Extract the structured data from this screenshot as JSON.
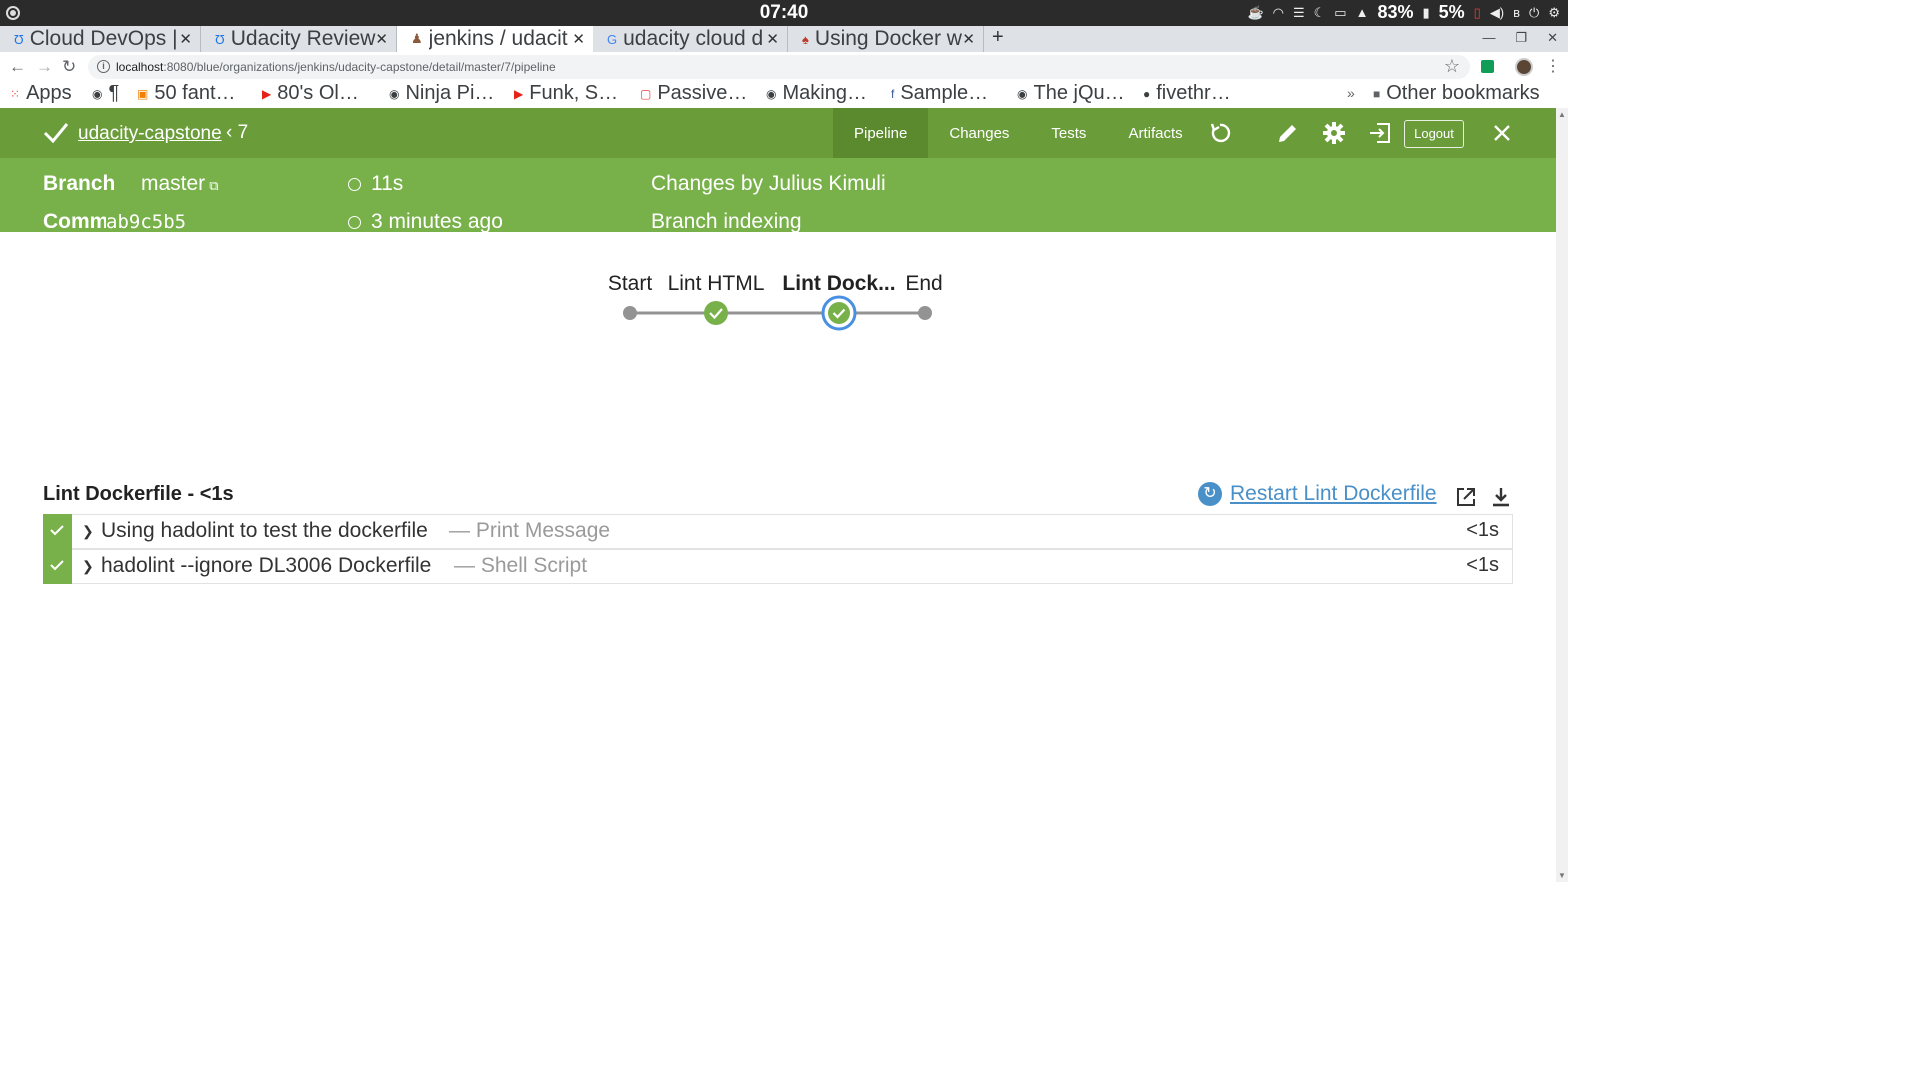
{
  "os": {
    "clock": "07:40",
    "tray": {
      "battery1": "83%",
      "battery2": "5%"
    }
  },
  "browser": {
    "tabs": [
      {
        "title": "Cloud DevOps |",
        "active": false
      },
      {
        "title": "Udacity Review",
        "active": false
      },
      {
        "title": "jenkins / udacit",
        "active": true
      },
      {
        "title": "udacity cloud d",
        "active": false
      },
      {
        "title": "Using Docker w",
        "active": false
      }
    ],
    "url_host": "localhost",
    "url_rest": ":8080/blue/organizations/jenkins/udacity-capstone/detail/master/7/pipeline",
    "bookmarks": [
      {
        "label": "Apps",
        "icon": "apps-icon"
      },
      {
        "label": "¶",
        "icon": "globe-icon"
      },
      {
        "label": "50 fant…",
        "icon": "blogger-icon"
      },
      {
        "label": "80's Ol…",
        "icon": "youtube-icon"
      },
      {
        "label": "Ninja Pi…",
        "icon": "globe-icon"
      },
      {
        "label": "Funk, S…",
        "icon": "youtube-icon"
      },
      {
        "label": "Passive…",
        "icon": "bookmark-icon"
      },
      {
        "label": "Making…",
        "icon": "globe-icon"
      },
      {
        "label": "Sample…",
        "icon": "facebook-icon"
      },
      {
        "label": "The jQu…",
        "icon": "globe-icon"
      },
      {
        "label": "fivethr…",
        "icon": "github-icon"
      }
    ],
    "other_bookmarks": "Other bookmarks"
  },
  "jenkins": {
    "repo": "udacity-capstone",
    "run_number": "7",
    "tabs": [
      "Pipeline",
      "Changes",
      "Tests",
      "Artifacts"
    ],
    "active_tab": "Pipeline",
    "logout": "Logout",
    "branch_label": "Branch",
    "branch_value": "master",
    "commit_label": "Commit",
    "commit_value": "ab9c5b5",
    "duration": "11s",
    "time_ago": "3 minutes ago",
    "changes": "Changes by Julius Kimuli",
    "cause": "Branch indexing",
    "accent_color": "#78b14a",
    "header_color": "#6a9c3a"
  },
  "pipeline": {
    "stages": [
      {
        "label": "Start",
        "type": "terminal"
      },
      {
        "label": "Lint HTML",
        "type": "success"
      },
      {
        "label": "Lint Dock...",
        "type": "success",
        "selected": true
      },
      {
        "label": "End",
        "type": "terminal"
      }
    ]
  },
  "steps_panel": {
    "title": "Lint Dockerfile - <1s",
    "restart": "Restart Lint Dockerfile",
    "steps": [
      {
        "name": "Using hadolint to test the dockerfile",
        "type": "— Print Message",
        "duration": "<1s",
        "status": "success"
      },
      {
        "name": "hadolint --ignore DL3006 Dockerfile",
        "type": "— Shell Script",
        "duration": "<1s",
        "status": "success"
      }
    ]
  }
}
